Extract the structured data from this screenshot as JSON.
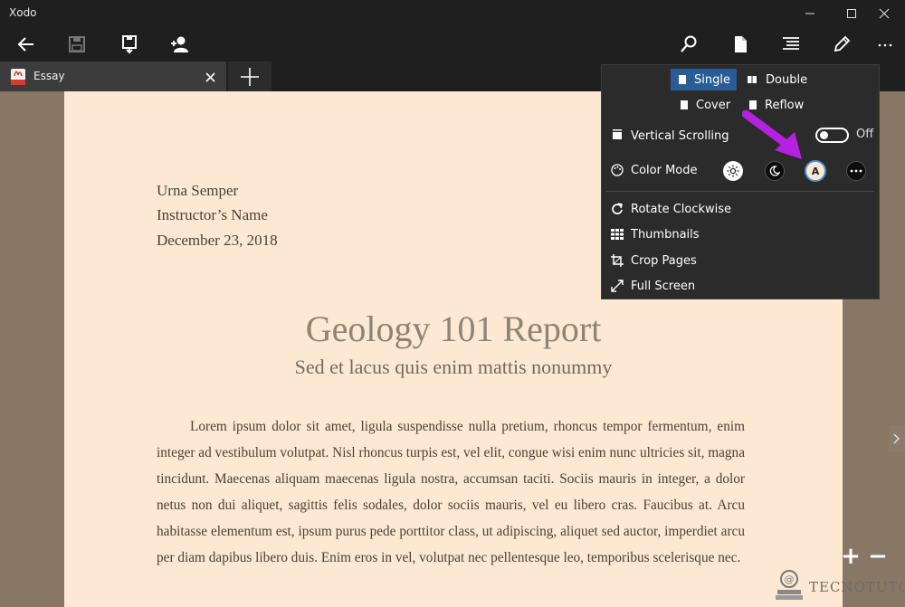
{
  "window": {
    "title": "Xodo"
  },
  "toolbar": {
    "icons": [
      "back-arrow-icon",
      "save-icon",
      "save-as-icon",
      "share-user-icon",
      "search-icon",
      "page-icon",
      "outline-icon",
      "pen-icon",
      "more-icon"
    ]
  },
  "tab": {
    "label": "Essay",
    "new_tab": "+"
  },
  "document": {
    "author_lines": [
      "Urna Semper",
      "Instructor’s Name",
      "December 23, 2018"
    ],
    "title": "Geology 101 Report",
    "subtitle": "Sed et lacus quis enim mattis nonummy",
    "body": "Lorem ipsum dolor sit amet, ligula suspendisse nulla pretium, rhoncus tempor fermentum, enim integer ad vestibulum volutpat. Nisl rhoncus turpis est, vel elit, congue wisi enim nunc ultricies sit, magna tincidunt. Maecenas aliquam maecenas ligula nostra, accumsan taciti. Sociis mauris in integer, a dolor netus non dui aliquet, sagittis felis sodales, dolor sociis mauris, vel eu libero cras. Faucibus at. Arcu habitasse elementum est, ipsum purus pede porttitor class, ut adipiscing, aliquet sed auctor, imperdiet arcu per diam dapibus libero duis. Enim eros in vel, volutpat nec pellentesque leo, temporibus scelerisque nec."
  },
  "flyout": {
    "modes": {
      "single": "Single",
      "double": "Double",
      "cover": "Cover",
      "reflow": "Reflow",
      "active": "Single"
    },
    "vertical_scrolling": {
      "label": "Vertical Scrolling",
      "state": "Off"
    },
    "color_mode": {
      "label": "Color Mode",
      "options": [
        "day",
        "night",
        "custom",
        "more"
      ],
      "custom_letter": "A"
    },
    "actions": {
      "rotate": "Rotate Clockwise",
      "thumbnails": "Thumbnails",
      "crop": "Crop Pages",
      "fullscreen": "Full Screen"
    }
  },
  "zoom": {
    "in": "+",
    "out": "−"
  },
  "watermark": {
    "text": "TECNOTUTO"
  },
  "colors": {
    "accent": "#2a5d96",
    "page_background": "#fde9d3",
    "annotation_arrow": "#b620e0"
  }
}
